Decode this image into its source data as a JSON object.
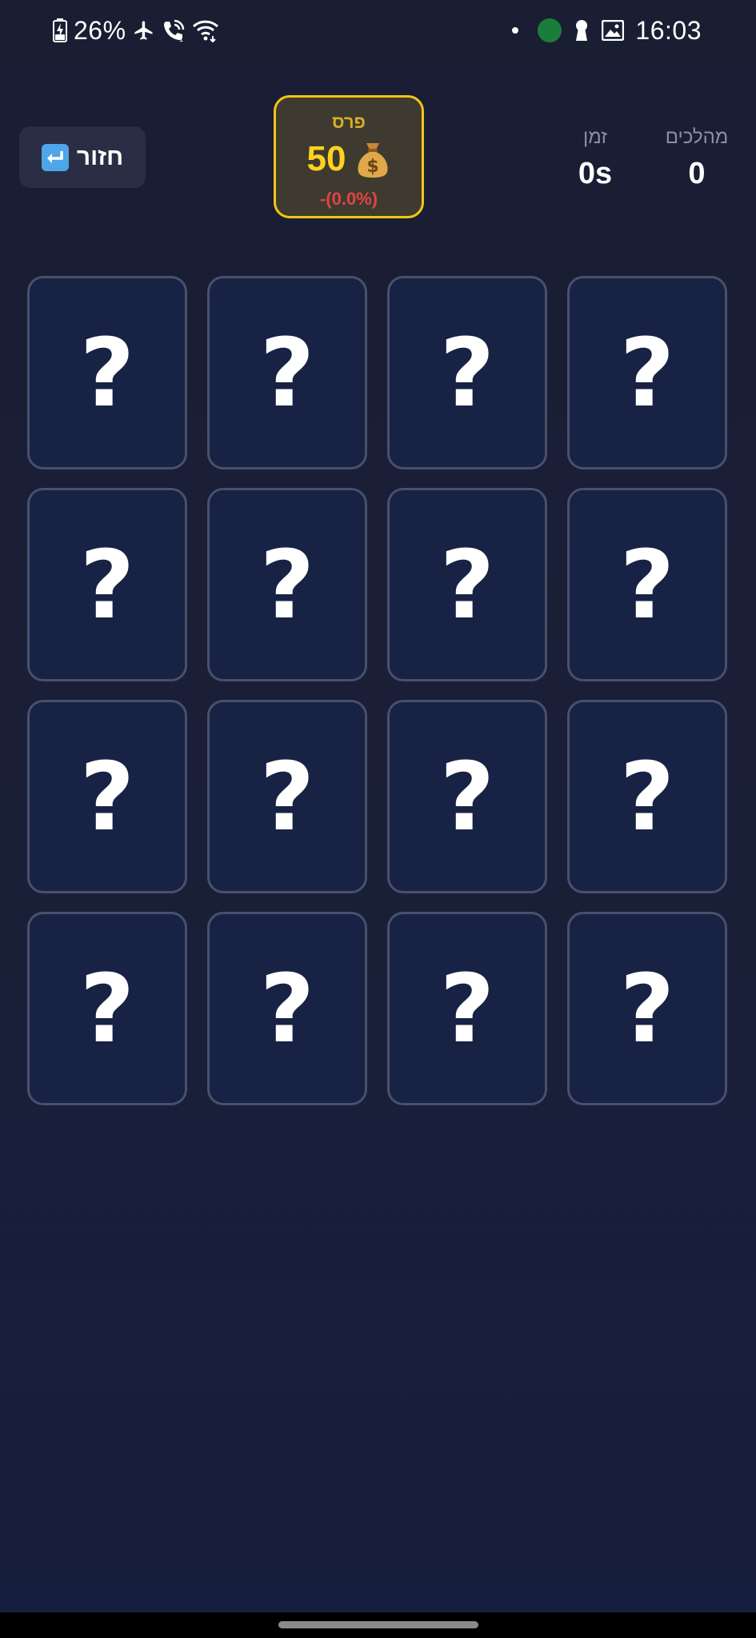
{
  "status_bar": {
    "battery": "26%",
    "time": "16:03",
    "icons": [
      "battery-charging-icon",
      "airplane-icon",
      "wifi-calling-icon",
      "wifi-icon",
      "notification-dot-icon",
      "app-badge-icon",
      "keyhole-icon",
      "gallery-icon"
    ]
  },
  "header": {
    "back_label": "חזור",
    "back_icon": "return-arrow-icon",
    "prize": {
      "title": "פרס",
      "value": "50",
      "icon": "money-bag-icon",
      "percent": "-(0.0%)"
    },
    "stats": {
      "time_label": "זמן",
      "time_value": "0s",
      "moves_label": "מהלכים",
      "moves_value": "0"
    }
  },
  "cards": [
    {
      "face": "?"
    },
    {
      "face": "?"
    },
    {
      "face": "?"
    },
    {
      "face": "?"
    },
    {
      "face": "?"
    },
    {
      "face": "?"
    },
    {
      "face": "?"
    },
    {
      "face": "?"
    },
    {
      "face": "?"
    },
    {
      "face": "?"
    },
    {
      "face": "?"
    },
    {
      "face": "?"
    },
    {
      "face": "?"
    },
    {
      "face": "?"
    },
    {
      "face": "?"
    },
    {
      "face": "?"
    }
  ],
  "colors": {
    "accent_gold": "#f2c515",
    "card_background": "#172244",
    "loss_red": "#e04545"
  }
}
